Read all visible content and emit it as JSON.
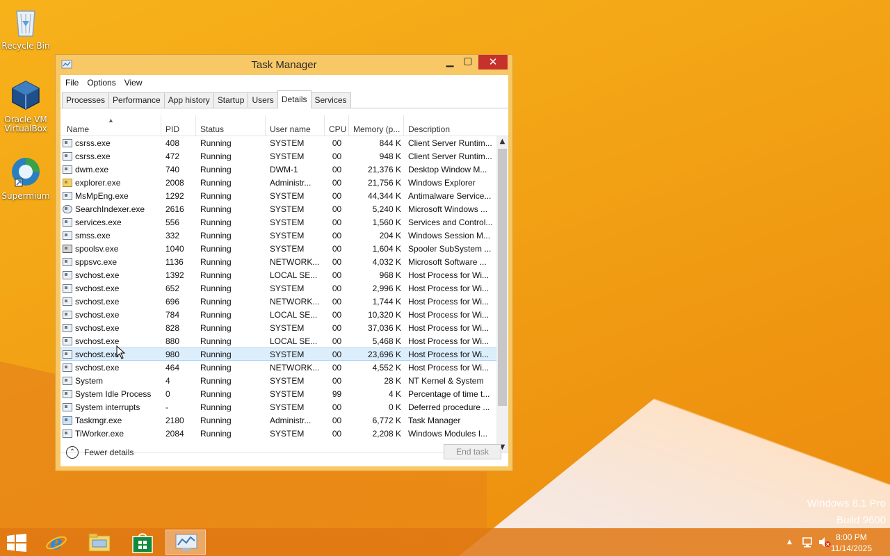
{
  "desktop": {
    "icons": [
      {
        "label": "Recycle Bin"
      },
      {
        "label": "Oracle VM VirtualBox"
      },
      {
        "label": "Supermium"
      }
    ],
    "watermark": {
      "line1": "Windows 8.1 Pro",
      "line2": "Build 9600"
    }
  },
  "window": {
    "title": "Task Manager",
    "menu": [
      "File",
      "Options",
      "View"
    ],
    "tabs": [
      "Processes",
      "Performance",
      "App history",
      "Startup",
      "Users",
      "Details",
      "Services"
    ],
    "active_tab": "Details",
    "columns": [
      "Name",
      "PID",
      "Status",
      "User name",
      "CPU",
      "Memory (p...",
      "Description"
    ],
    "rows": [
      {
        "name": "csrss.exe",
        "pid": "408",
        "status": "Running",
        "user": "SYSTEM",
        "cpu": "00",
        "mem": "844 K",
        "desc": "Client Server Runtim...",
        "icon": "app"
      },
      {
        "name": "csrss.exe",
        "pid": "472",
        "status": "Running",
        "user": "SYSTEM",
        "cpu": "00",
        "mem": "948 K",
        "desc": "Client Server Runtim...",
        "icon": "app"
      },
      {
        "name": "dwm.exe",
        "pid": "740",
        "status": "Running",
        "user": "DWM-1",
        "cpu": "00",
        "mem": "21,376 K",
        "desc": "Desktop Window M...",
        "icon": "app"
      },
      {
        "name": "explorer.exe",
        "pid": "2008",
        "status": "Running",
        "user": "Administr...",
        "cpu": "00",
        "mem": "21,756 K",
        "desc": "Windows Explorer",
        "icon": "folder"
      },
      {
        "name": "MsMpEng.exe",
        "pid": "1292",
        "status": "Running",
        "user": "SYSTEM",
        "cpu": "00",
        "mem": "44,344 K",
        "desc": "Antimalware Service...",
        "icon": "app"
      },
      {
        "name": "SearchIndexer.exe",
        "pid": "2616",
        "status": "Running",
        "user": "SYSTEM",
        "cpu": "00",
        "mem": "5,240 K",
        "desc": "Microsoft Windows ...",
        "icon": "search"
      },
      {
        "name": "services.exe",
        "pid": "556",
        "status": "Running",
        "user": "SYSTEM",
        "cpu": "00",
        "mem": "1,560 K",
        "desc": "Services and Control...",
        "icon": "app"
      },
      {
        "name": "smss.exe",
        "pid": "332",
        "status": "Running",
        "user": "SYSTEM",
        "cpu": "00",
        "mem": "204 K",
        "desc": "Windows Session M...",
        "icon": "app"
      },
      {
        "name": "spoolsv.exe",
        "pid": "1040",
        "status": "Running",
        "user": "SYSTEM",
        "cpu": "00",
        "mem": "1,604 K",
        "desc": "Spooler SubSystem ...",
        "icon": "printer"
      },
      {
        "name": "sppsvc.exe",
        "pid": "1136",
        "status": "Running",
        "user": "NETWORK...",
        "cpu": "00",
        "mem": "4,032 K",
        "desc": "Microsoft Software ...",
        "icon": "app"
      },
      {
        "name": "svchost.exe",
        "pid": "1392",
        "status": "Running",
        "user": "LOCAL SE...",
        "cpu": "00",
        "mem": "968 K",
        "desc": "Host Process for Wi...",
        "icon": "app"
      },
      {
        "name": "svchost.exe",
        "pid": "652",
        "status": "Running",
        "user": "SYSTEM",
        "cpu": "00",
        "mem": "2,996 K",
        "desc": "Host Process for Wi...",
        "icon": "app"
      },
      {
        "name": "svchost.exe",
        "pid": "696",
        "status": "Running",
        "user": "NETWORK...",
        "cpu": "00",
        "mem": "1,744 K",
        "desc": "Host Process for Wi...",
        "icon": "app"
      },
      {
        "name": "svchost.exe",
        "pid": "784",
        "status": "Running",
        "user": "LOCAL SE...",
        "cpu": "00",
        "mem": "10,320 K",
        "desc": "Host Process for Wi...",
        "icon": "app"
      },
      {
        "name": "svchost.exe",
        "pid": "828",
        "status": "Running",
        "user": "SYSTEM",
        "cpu": "00",
        "mem": "37,036 K",
        "desc": "Host Process for Wi...",
        "icon": "app"
      },
      {
        "name": "svchost.exe",
        "pid": "880",
        "status": "Running",
        "user": "LOCAL SE...",
        "cpu": "00",
        "mem": "5,468 K",
        "desc": "Host Process for Wi...",
        "icon": "app"
      },
      {
        "name": "svchost.exe",
        "pid": "980",
        "status": "Running",
        "user": "SYSTEM",
        "cpu": "00",
        "mem": "23,696 K",
        "desc": "Host Process for Wi...",
        "icon": "app",
        "selected": true
      },
      {
        "name": "svchost.exe",
        "pid": "464",
        "status": "Running",
        "user": "NETWORK...",
        "cpu": "00",
        "mem": "4,552 K",
        "desc": "Host Process for Wi...",
        "icon": "app"
      },
      {
        "name": "System",
        "pid": "4",
        "status": "Running",
        "user": "SYSTEM",
        "cpu": "00",
        "mem": "28 K",
        "desc": "NT Kernel & System",
        "icon": "app"
      },
      {
        "name": "System Idle Process",
        "pid": "0",
        "status": "Running",
        "user": "SYSTEM",
        "cpu": "99",
        "mem": "4 K",
        "desc": "Percentage of time t...",
        "icon": "app"
      },
      {
        "name": "System interrupts",
        "pid": "-",
        "status": "Running",
        "user": "SYSTEM",
        "cpu": "00",
        "mem": "0 K",
        "desc": "Deferred procedure ...",
        "icon": "app"
      },
      {
        "name": "Taskmgr.exe",
        "pid": "2180",
        "status": "Running",
        "user": "Administr...",
        "cpu": "00",
        "mem": "6,772 K",
        "desc": "Task Manager",
        "icon": "tm"
      },
      {
        "name": "TiWorker.exe",
        "pid": "2084",
        "status": "Running",
        "user": "SYSTEM",
        "cpu": "00",
        "mem": "2,208 K",
        "desc": "Windows Modules I...",
        "icon": "app"
      }
    ],
    "footer": {
      "fewer_details": "Fewer details",
      "end_task": "End task"
    }
  },
  "taskbar": {
    "clock_time": "8:00 PM",
    "clock_date": "11/14/2025"
  },
  "colors": {
    "selection": "#dceefc",
    "close_button": "#c7312b",
    "window_frame": "#f8c866"
  }
}
